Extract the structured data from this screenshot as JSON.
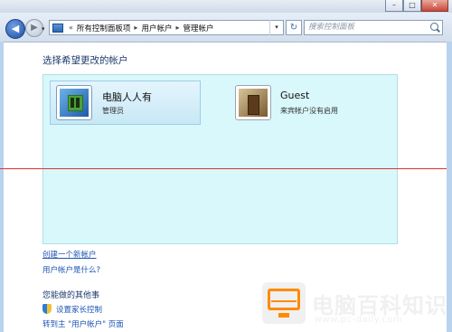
{
  "window": {
    "minimize": "–",
    "maximize": "□",
    "close": "✕"
  },
  "nav": {
    "back": "◀",
    "forward": "▶",
    "recent_dropdown": "▾",
    "breadcrumbs": [
      "所有控制面板项",
      "用户帐户",
      "管理帐户"
    ],
    "crumb_prefix": "«",
    "separator": "▸",
    "address_dropdown": "▾",
    "refresh": "↻",
    "search_placeholder": "搜索控制面板"
  },
  "main": {
    "heading": "选择希望更改的帐户",
    "accounts": [
      {
        "name": "电脑人人有",
        "role": "管理员",
        "icon": "admin-account-icon",
        "selected": true
      },
      {
        "name": "Guest",
        "role": "来宾帐户没有启用",
        "icon": "guest-account-icon",
        "selected": false
      }
    ],
    "links": {
      "create": "创建一个新帐户",
      "what_is": "用户帐户是什么?"
    },
    "other_heading": "您能做的其他事",
    "tasks": {
      "parental": "设置家长控制",
      "goto": "转到主 \"用户帐户\" 页面"
    }
  },
  "watermark": {
    "title": "电脑百科知识",
    "url": "www.pc-daily.com",
    "accent": "#ff8a00"
  }
}
